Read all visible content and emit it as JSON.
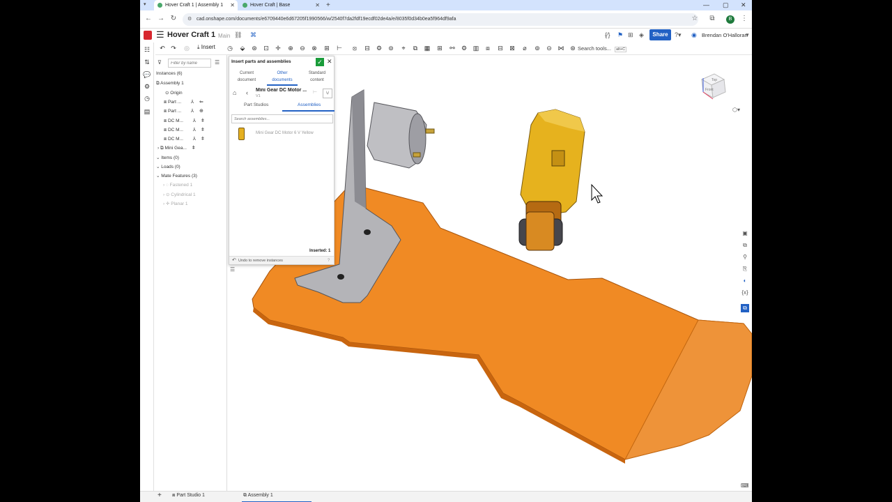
{
  "browser": {
    "tabs": [
      {
        "title": "Hover Craft 1 | Assembly 1",
        "active": true
      },
      {
        "title": "Hover Craft | Base",
        "active": false
      }
    ],
    "url": "cad.onshape.com/documents/e6709440e6d67205f1990566/w/2540f7da2fdf19ecdf02de4a/e/8035f0d34b0ea5f964df9afa"
  },
  "header": {
    "document_title": "Hover Craft 1",
    "branch": "Main",
    "share_label": "Share",
    "user_name": "Brendan O'Halloran",
    "user_initial": "B"
  },
  "toolbar": {
    "insert_label": "Insert",
    "search_tools_label": "Search tools..."
  },
  "instances": {
    "filter_placeholder": "Filter by name",
    "heading": "Instances (6)",
    "assembly": "Assembly 1",
    "origin": "Origin",
    "items": [
      "Part ...",
      "Part ...",
      "DC M...",
      "DC M...",
      "DC M...",
      "Mini Gea..."
    ],
    "sections": [
      "Items (0)",
      "Loads (0)",
      "Mate Features (3)"
    ],
    "mates": [
      "Fastened 1",
      "Cylindrical 1",
      "Planar 1"
    ]
  },
  "dialog": {
    "title": "Insert parts and assemblies",
    "tabs": [
      {
        "line1": "Current",
        "line2": "document"
      },
      {
        "line1": "Other",
        "line2": "documents"
      },
      {
        "line1": "Standard",
        "line2": "content"
      }
    ],
    "doc_name": "Mini Gear DC Motor ...",
    "version": "V1",
    "subtabs": [
      "Part Studios",
      "Assemblies"
    ],
    "search_placeholder": "Search assemblies...",
    "result": "Mini Gear DC Motor 6 V Yellow",
    "inserted": "Inserted: 1",
    "undo": "Undo to remove instances"
  },
  "viewcube": {
    "top": "Top",
    "front": "Front"
  },
  "bottom_tabs": [
    "Part Studio 1",
    "Assembly 1"
  ],
  "colors": {
    "accent": "#2261c4",
    "part_orange": "#f08a24",
    "motor_yellow": "#e6b21e",
    "bracket_gray": "#a9a9ad"
  }
}
